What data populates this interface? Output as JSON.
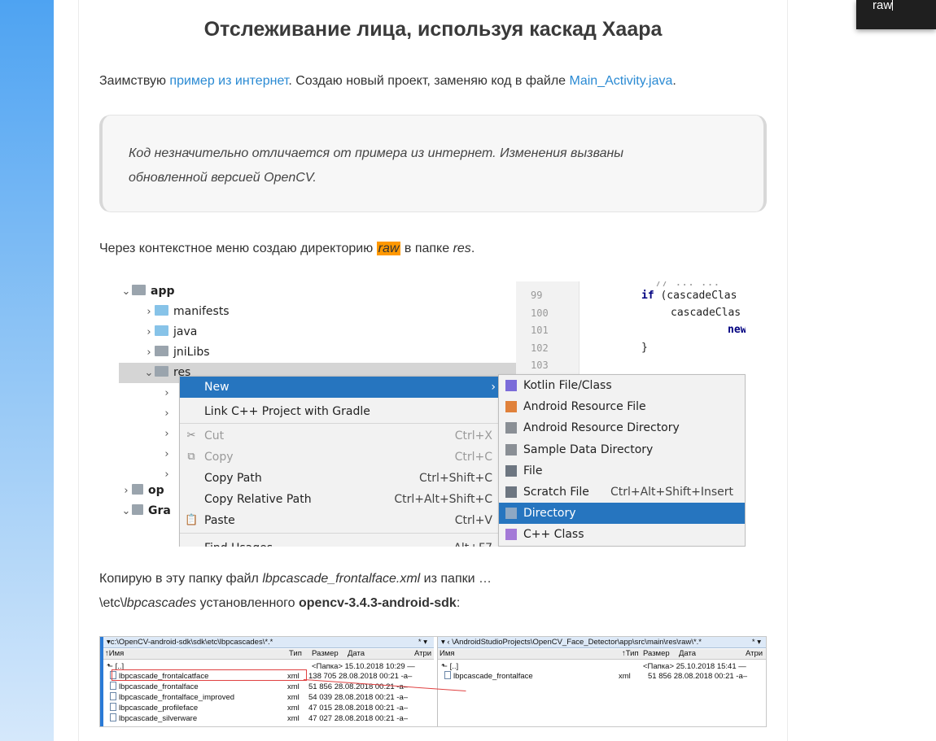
{
  "article": {
    "title": "Отслеживание лица, используя каскад Хаара",
    "p1_before": "Заимствую ",
    "p1_link1": "пример из интернет",
    "p1_mid": ". Создаю новый проект, заменяю код в файле ",
    "p1_link2": "Main_Activity.java",
    "p1_end": ".",
    "quote_line1": "Код незначительно отличается от примера из интернет. Изменения вызваны",
    "quote_line2": "обновленной версией OpenCV.",
    "p2_before": "Через контекстное меню создаю директорию ",
    "p2_highlight": "raw",
    "p2_mid": " в папке ",
    "p2_italic": "res",
    "p2_end": ".",
    "p3_before": "Копирую в эту папку  файл ",
    "p3_italic": "lbpcascade_frontalface.xml",
    "p3_after": " из папки …",
    "p4_before": "\\etc\\",
    "p4_italic": "lbpcascades",
    "p4_mid": " установленного ",
    "p4_bold": "opencv-3.4.3-android-sdk",
    "p4_end": ":"
  },
  "search_tooltip": {
    "text": "raw"
  },
  "ide": {
    "tree": [
      {
        "label": "app",
        "chevron": "⌄",
        "bold": true
      },
      {
        "label": "manifests",
        "chevron": "›"
      },
      {
        "label": "java",
        "chevron": "›"
      },
      {
        "label": "jniLibs",
        "chevron": "›"
      },
      {
        "label": "res",
        "chevron": "⌄"
      }
    ],
    "tree_more": [
      "›",
      "›",
      "›",
      "›",
      "›"
    ],
    "tree_bottom": [
      {
        "label": "op",
        "chevron": "›"
      },
      {
        "label": "Gra",
        "chevron": "⌄"
      }
    ],
    "line_numbers": [
      "99",
      "100",
      "101",
      "102",
      "103"
    ],
    "code": [
      "// ... ...",
      "if (cascadeClas",
      "cascadeClas",
      "new",
      "}"
    ],
    "context_menu": [
      {
        "label": "New",
        "shortcut": "",
        "state": "active"
      },
      {
        "label": "Link C++ Project with Gradle",
        "shortcut": "",
        "state": "normal"
      },
      {
        "label": "Cut",
        "shortcut": "Ctrl+X",
        "state": "disabled"
      },
      {
        "label": "Copy",
        "shortcut": "Ctrl+C",
        "state": "disabled"
      },
      {
        "label": "Copy Path",
        "shortcut": "Ctrl+Shift+C",
        "state": "normal"
      },
      {
        "label": "Copy Relative Path",
        "shortcut": "Ctrl+Alt+Shift+C",
        "state": "normal"
      },
      {
        "label": "Paste",
        "shortcut": "Ctrl+V",
        "state": "normal"
      },
      {
        "label": "Find Usages",
        "shortcut": "Alt+F7",
        "state": "normal"
      }
    ],
    "new_submenu": [
      {
        "label": "Kotlin File/Class",
        "shortcut": ""
      },
      {
        "label": "Android Resource File",
        "shortcut": ""
      },
      {
        "label": "Android Resource Directory",
        "shortcut": ""
      },
      {
        "label": "Sample Data Directory",
        "shortcut": ""
      },
      {
        "label": "File",
        "shortcut": ""
      },
      {
        "label": "Scratch File",
        "shortcut": "Ctrl+Alt+Shift+Insert"
      },
      {
        "label": "Directory",
        "shortcut": "",
        "active": true
      },
      {
        "label": "C++ Class",
        "shortcut": ""
      }
    ]
  },
  "total_commander": {
    "left_path": "▾c:\\OpenCV-android-sdk\\sdk\\etc\\lbpcascades\\*.*",
    "right_path": "▾ ‹ \\AndroidStudioProjects\\OpenCV_Face_Detector\\app\\src\\main\\res\\raw\\*.*",
    "star": "* ▾",
    "left_headers": [
      "↑Имя",
      "Тип",
      "Размер",
      "Дата",
      "Атри"
    ],
    "right_headers": [
      "Имя",
      "↑Тип",
      "Размер",
      "Дата",
      "Атри"
    ],
    "up_row_left": {
      "name": "[..]",
      "info": "<Папка> 15.10.2018 10:29 —"
    },
    "up_row_right": {
      "name": "[..]",
      "info": "<Папка> 25.10.2018 15:41 —"
    },
    "left_files": [
      {
        "name": "lbpcascade_frontalcatface",
        "ext": "xml",
        "info": "138 705 28.08.2018 00:21 -a–"
      },
      {
        "name": "lbpcascade_frontalface",
        "ext": "xml",
        "info": "51 856 28.08.2018 00:21 -a–"
      },
      {
        "name": "lbpcascade_frontalface_improved",
        "ext": "xml",
        "info": "54 039 28.08.2018 00:21 -a–"
      },
      {
        "name": "lbpcascade_profileface",
        "ext": "xml",
        "info": "47 015 28.08.2018 00:21 -a–"
      },
      {
        "name": "lbpcascade_silverware",
        "ext": "xml",
        "info": "47 027 28.08.2018 00:21 -a–"
      }
    ],
    "right_files": [
      {
        "name": "lbpcascade_frontalface",
        "ext": "xml",
        "info": "51 856 28.08.2018 00:21 -a–"
      }
    ]
  }
}
